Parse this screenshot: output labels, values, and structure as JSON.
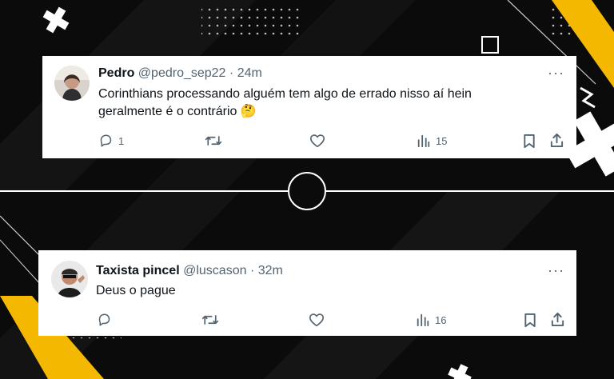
{
  "tweets": [
    {
      "author_name": "Pedro",
      "handle": "@pedro_sep22",
      "separator": "·",
      "time": "24m",
      "text_line1": "Corinthians processando alguém tem algo de errado nisso aí hein",
      "text_line2": "geralmente é o contrário",
      "emoji": "🤔",
      "replies": "1",
      "views": "15",
      "more_label": "···"
    },
    {
      "author_name": "Taxista pincel",
      "handle": "@luscason",
      "separator": "·",
      "time": "32m",
      "text_line1": "Deus o pague",
      "views": "16",
      "more_label": "···"
    }
  ],
  "colors": {
    "accent_yellow": "#f5b800",
    "background": "#0b0b0b",
    "card": "#ffffff",
    "muted": "#536471"
  }
}
